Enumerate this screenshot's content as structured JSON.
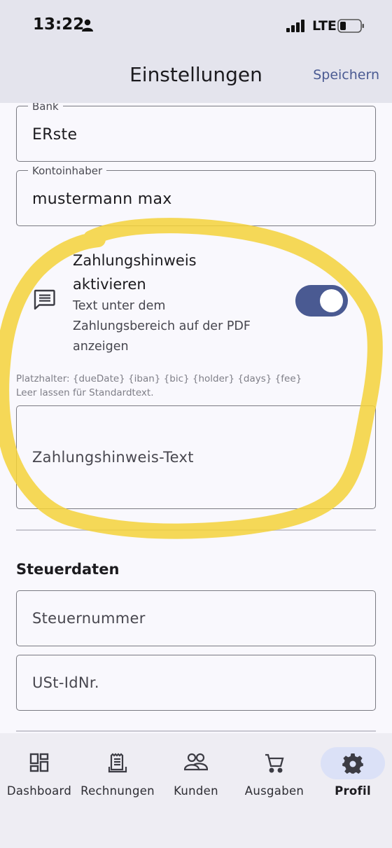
{
  "status_bar": {
    "time": "13:22",
    "network": "LTE"
  },
  "header": {
    "title": "Einstellungen",
    "save_label": "Speichern"
  },
  "bank_field": {
    "label": "Bank",
    "value": "ERste"
  },
  "holder_field": {
    "label": "Kontoinhaber",
    "value": "mustermann max"
  },
  "payment_note_toggle": {
    "title_line1": "Zahlungshinweis",
    "title_line2": "aktivieren",
    "subtitle_line1": "Text unter dem",
    "subtitle_line2": "Zahlungsbereich auf der PDF",
    "subtitle_line3": "anzeigen",
    "enabled": true,
    "icon": "chat-icon"
  },
  "placeholder_hint": {
    "line1": "Platzhalter: {dueDate} {iban} {bic} {holder} {days} {fee}",
    "line2": "Leer lassen für Standardtext."
  },
  "payment_note_field": {
    "placeholder": "Zahlungshinweis-Text"
  },
  "tax_section": {
    "title": "Steuerdaten",
    "tax_number_placeholder": "Steuernummer",
    "vat_id_placeholder": "USt-IdNr."
  },
  "nav": {
    "items": [
      {
        "label": "Dashboard",
        "icon": "dashboard-icon"
      },
      {
        "label": "Rechnungen",
        "icon": "receipt-icon"
      },
      {
        "label": "Kunden",
        "icon": "people-icon"
      },
      {
        "label": "Ausgaben",
        "icon": "cart-icon"
      },
      {
        "label": "Profil",
        "icon": "gear-icon",
        "active": true
      }
    ]
  },
  "colors": {
    "accent": "#4a5a92",
    "highlight_marker": "#f5d23a",
    "header_bg": "#e4e4ed",
    "nav_active_bg": "#dbe1f7"
  }
}
